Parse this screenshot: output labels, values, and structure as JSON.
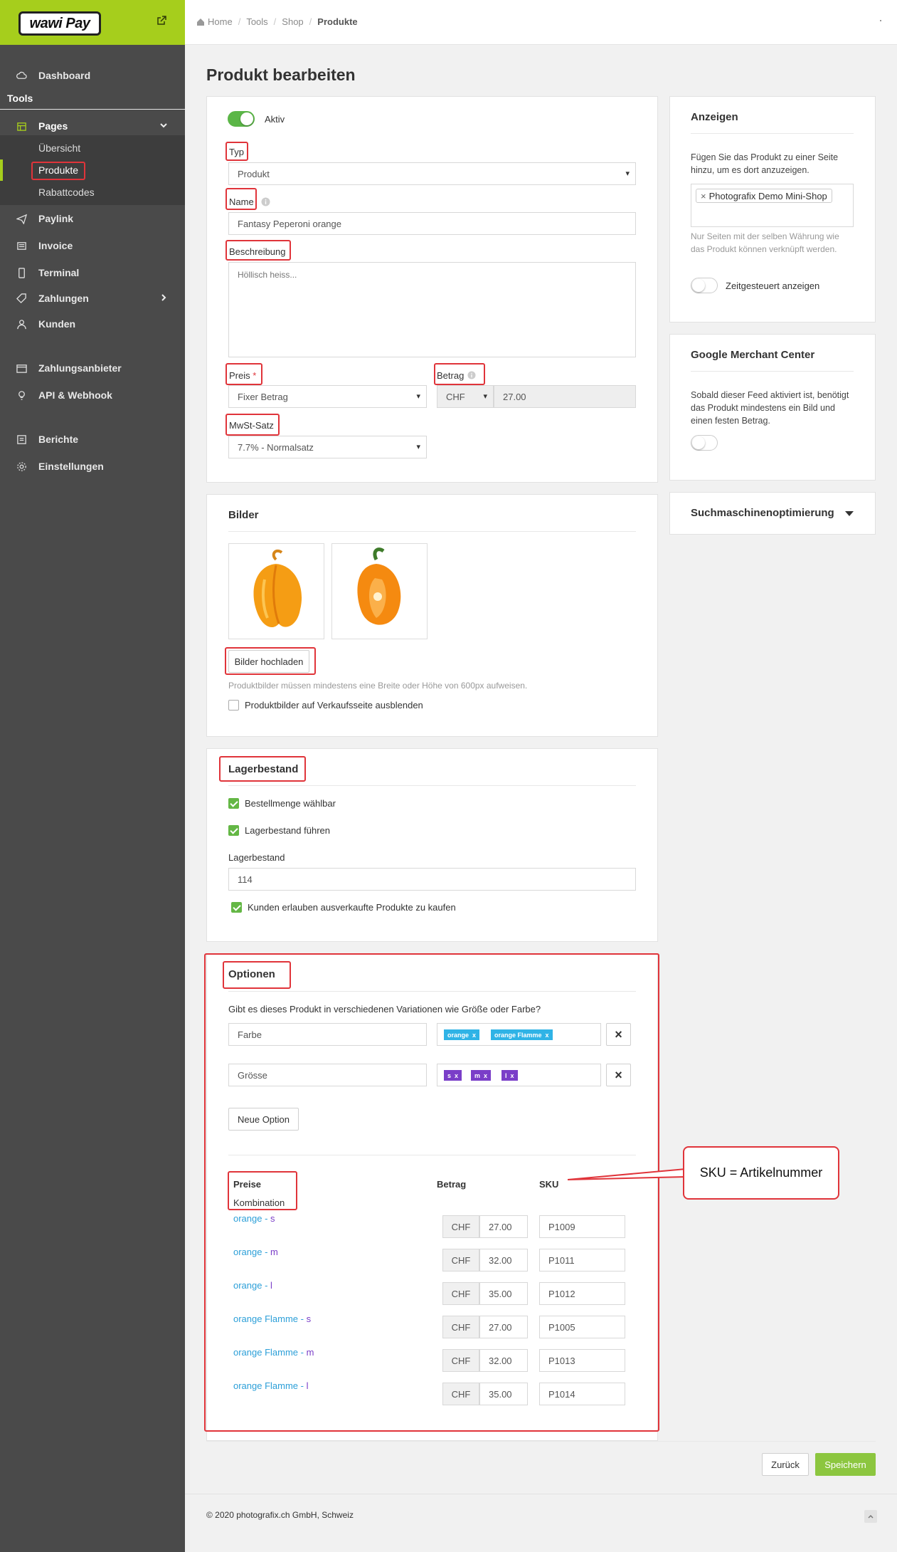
{
  "brand": {
    "logo_text": "wawi Pay",
    "accent": "#a6ce1c"
  },
  "sidebar": {
    "dashboard": "Dashboard",
    "tools_header": "Tools",
    "pages": "Pages",
    "sub": [
      "Übersicht",
      "Produkte",
      "Rabattcodes"
    ],
    "items": [
      "Paylink",
      "Invoice",
      "Terminal",
      "Zahlungen",
      "Kunden",
      "Zahlungsanbieter",
      "API & Webhook",
      "Berichte",
      "Einstellungen"
    ]
  },
  "breadcrumb": [
    "Home",
    "Tools",
    "Shop",
    "Produkte"
  ],
  "page_title": "Produkt bearbeiten",
  "main": {
    "aktiv_label": "Aktiv",
    "typ_label": "Typ",
    "typ_value": "Produkt",
    "name_label": "Name",
    "name_value": "Fantasy Peperoni orange",
    "beschreibung_label": "Beschreibung",
    "beschreibung_value": "Höllisch heiss...",
    "preis_label": "Preis",
    "preis_value": "Fixer Betrag",
    "betrag_label": "Betrag",
    "currency": "CHF",
    "betrag_value": "27.00",
    "mwst_label": "MwSt-Satz",
    "mwst_value": "7.7% - Normalsatz"
  },
  "bilder": {
    "title": "Bilder",
    "upload_button": "Bilder hochladen",
    "hint": "Produktbilder müssen mindestens eine Breite oder Höhe von 600px aufweisen.",
    "hide_checkbox": "Produktbilder auf Verkaufsseite ausblenden"
  },
  "lager": {
    "title": "Lagerbestand",
    "cb1": "Bestellmenge wählbar",
    "cb2": "Lagerbestand führen",
    "stock_label": "Lagerbestand",
    "stock_value": "114",
    "cb3": "Kunden erlauben ausverkaufte Produkte zu kaufen"
  },
  "optionen": {
    "title": "Optionen",
    "question": "Gibt es dieses Produkt in verschiedenen Variationen wie Größe oder Farbe?",
    "opt1_name": "Farbe",
    "opt1_tags": [
      "orange",
      "orange Flamme"
    ],
    "opt2_name": "Grösse",
    "opt2_tags": [
      "s",
      "m",
      "l"
    ],
    "tag_remove": "x",
    "remove_icon": "×",
    "new_option": "Neue Option",
    "preise_label": "Preise",
    "kombination_label": "Kombination",
    "betrag_col": "Betrag",
    "sku_col": "SKU",
    "rows": [
      {
        "c1": "orange",
        "c2": "s",
        "betrag": "27.00",
        "sku": "P1009"
      },
      {
        "c1": "orange",
        "c2": "m",
        "betrag": "32.00",
        "sku": "P1011"
      },
      {
        "c1": "orange",
        "c2": "l",
        "betrag": "35.00",
        "sku": "P1012"
      },
      {
        "c1": "orange Flamme",
        "c2": "s",
        "betrag": "27.00",
        "sku": "P1005"
      },
      {
        "c1": "orange Flamme",
        "c2": "m",
        "betrag": "32.00",
        "sku": "P1013"
      },
      {
        "c1": "orange Flamme",
        "c2": "l",
        "betrag": "35.00",
        "sku": "P1014"
      }
    ]
  },
  "right": {
    "anzeigen_title": "Anzeigen",
    "anzeigen_text": "Fügen Sie das Produkt zu einer Seite hinzu, um es dort anzuzeigen.",
    "shop_tag": "Photografix Demo Mini-Shop",
    "anzeigen_hint": "Nur Seiten mit der selben Währung wie das Produkt können verknüpft werden.",
    "zeitgesteuert": "Zeitgesteuert anzeigen",
    "gmc_title": "Google Merchant Center",
    "gmc_text": "Sobald dieser Feed aktiviert ist, benötigt das Produkt mindestens ein Bild und einen festen Betrag.",
    "seo_title": "Suchmaschinenoptimierung"
  },
  "actions": {
    "back": "Zurück",
    "save": "Speichern"
  },
  "footer": {
    "copyright": "© 2020 photografix.ch GmbH, Schweiz"
  },
  "annotation": {
    "sku_callout": "SKU = Artikelnummer"
  }
}
